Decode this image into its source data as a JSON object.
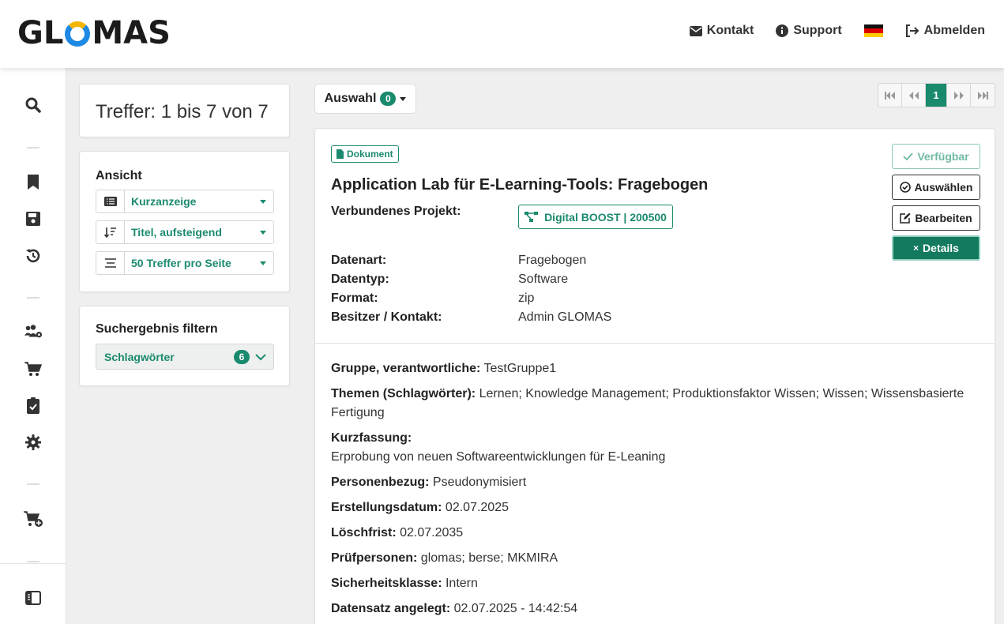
{
  "header": {
    "logo": "GLOMAS",
    "logo_parts": {
      "before": "GL",
      "after": "MAS"
    },
    "nav": {
      "contact": "Kontakt",
      "support": "Support",
      "logout": "Abmelden"
    },
    "language": "de"
  },
  "rail": {
    "icons": [
      "search-icon",
      "bookmark-icon",
      "save-icon",
      "history-icon",
      "users-gear-icon",
      "cart-icon",
      "clipboard-check-icon",
      "gear-icon",
      "cart-plus-icon",
      "sidebar-toggle-icon"
    ]
  },
  "hits": {
    "text": "Treffer: 1 bis 7 von 7"
  },
  "view": {
    "title": "Ansicht",
    "display_mode": "Kurzanzeige",
    "sort": "Titel, aufsteigend",
    "per_page": "50 Treffer pro Seite"
  },
  "filter": {
    "title": "Suchergebnis filtern",
    "keywords_label": "Schlagwörter",
    "keywords_count": "6"
  },
  "selection": {
    "label": "Auswahl",
    "count": "0"
  },
  "pagination": {
    "current": "1"
  },
  "result": {
    "type_badge": "Dokument",
    "title": "Application Lab für E-Learning-Tools: Fragebogen",
    "project_label": "Verbundenes Projekt:",
    "project": "Digital BOOST | 200500",
    "fields": [
      {
        "label": "Datenart:",
        "value": "Fragebogen"
      },
      {
        "label": "Datentyp:",
        "value": "Software"
      },
      {
        "label": "Format:",
        "value": "zip"
      },
      {
        "label": "Besitzer / Kontakt:",
        "value": "Admin GLOMAS"
      }
    ],
    "buttons": {
      "available": "Verfügbar",
      "select": "Auswählen",
      "edit": "Bearbeiten",
      "details": "Details"
    },
    "details": {
      "group_label": "Gruppe, verantwortliche:",
      "group": "TestGruppe1",
      "topics_label": "Themen (Schlagwörter):",
      "topics": "Lernen; Knowledge Management; Produktionsfaktor Wissen; Wissen; Wissensbasierte",
      "topics_cont": "Fertigung",
      "summary_label": "Kurzfassung:",
      "summary": "Erprobung von neuen Softwareentwicklungen für E-Leaning",
      "personal_label": "Personenbezug:",
      "personal": "Pseudonymisiert",
      "created_label": "Erstellungsdatum:",
      "created": "02.07.2025",
      "deletion_label": "Löschfrist:",
      "deletion": "02.07.2035",
      "reviewers_label": "Prüfpersonen:",
      "reviewers": "glomas; berse; MKMIRA",
      "security_label": "Sicherheitsklasse:",
      "security": "Intern",
      "record_label": "Datensatz angelegt:",
      "record": "02.07.2025 - 14:42:54"
    }
  },
  "colors": {
    "accent": "#1a8a6e",
    "accent_dark": "#137a5f",
    "logo_blue": "#1e88e5",
    "logo_yellow": "#f5b400"
  }
}
